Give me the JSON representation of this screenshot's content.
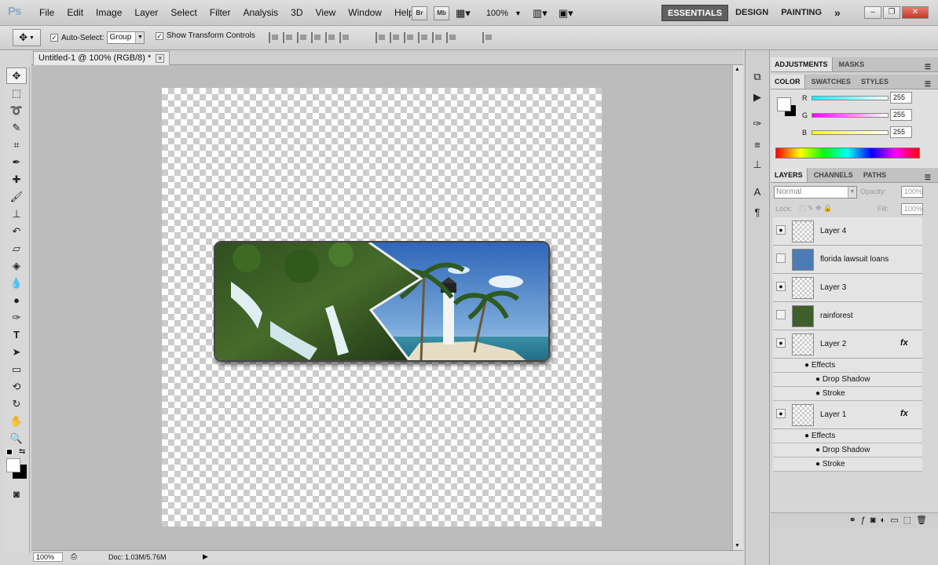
{
  "app": {
    "logo": "Ps"
  },
  "menu": [
    "File",
    "Edit",
    "Image",
    "Layer",
    "Select",
    "Filter",
    "Analysis",
    "3D",
    "View",
    "Window",
    "Help"
  ],
  "appbar": {
    "br": "Br",
    "mb": "Mb",
    "zoom": "100%"
  },
  "workspaces": {
    "essentials": "ESSENTIALS",
    "design": "DESIGN",
    "painting": "PAINTING",
    "more": "»"
  },
  "window": {
    "minimize": "–",
    "restore": "❐",
    "close": "✕"
  },
  "options": {
    "auto_select_label": "Auto-Select:",
    "auto_select_value": "Group",
    "transform_label": "Show Transform Controls"
  },
  "document": {
    "tab_title": "Untitled-1 @ 100% (RGB/8) *",
    "close": "×"
  },
  "status": {
    "zoom": "100%",
    "doc": "Doc: 1.03M/5.76M"
  },
  "panel_adjust": {
    "tabs": [
      "ADJUSTMENTS",
      "MASKS"
    ]
  },
  "panel_color": {
    "tabs": [
      "COLOR",
      "SWATCHES",
      "STYLES"
    ],
    "r_label": "R",
    "g_label": "G",
    "b_label": "B",
    "r": "255",
    "g": "255",
    "b": "255"
  },
  "panel_layers": {
    "tabs": [
      "LAYERS",
      "CHANNELS",
      "PATHS"
    ],
    "blend": "Normal",
    "opacity_label": "Opacity:",
    "opacity": "100%",
    "lock_label": "Lock:",
    "fill_label": "Fill:",
    "fill": "100%"
  },
  "layers": [
    {
      "name": "Layer 4",
      "visible": true
    },
    {
      "name": "florida lawsuit loans",
      "visible": false
    },
    {
      "name": "Layer 3",
      "visible": true
    },
    {
      "name": "rainforest",
      "visible": false
    },
    {
      "name": "Layer 2",
      "visible": true,
      "fx": "fx"
    },
    {
      "name": "Layer 1",
      "visible": true,
      "fx": "fx"
    }
  ],
  "effects": {
    "effects_label": "Effects",
    "drop_shadow": "Drop Shadow",
    "stroke": "Stroke"
  }
}
